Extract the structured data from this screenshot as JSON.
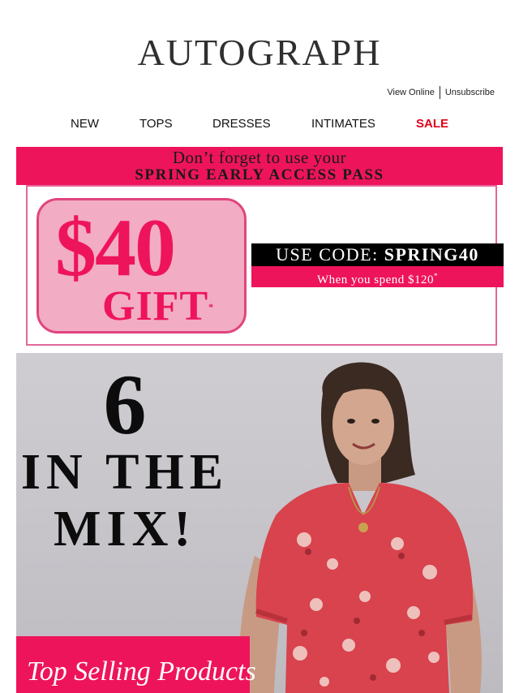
{
  "brand": {
    "logo": "AUTOGRAPH"
  },
  "header_links": {
    "view_online": "View Online",
    "unsubscribe": "Unsubscribe"
  },
  "nav": {
    "items": [
      "NEW",
      "TOPS",
      "DRESSES",
      "INTIMATES",
      "SALE"
    ]
  },
  "promo": {
    "line1": "Don’t forget to use your",
    "line2": "SPRING EARLY ACCESS PASS",
    "gift_amount": "$40",
    "gift_label": "GIFT",
    "code_prefix": "USE CODE:",
    "code": "SPRING40",
    "condition": "When you spend $120",
    "condition_mark": "*"
  },
  "hero": {
    "number": "6",
    "line2": "IN THE",
    "line3": "MIX!",
    "banner": "Top Selling Products"
  },
  "colors": {
    "accent_pink": "#ee145b",
    "light_pink": "#f2acc4",
    "sale_red": "#e2001a",
    "dress_red": "#d8434d"
  }
}
